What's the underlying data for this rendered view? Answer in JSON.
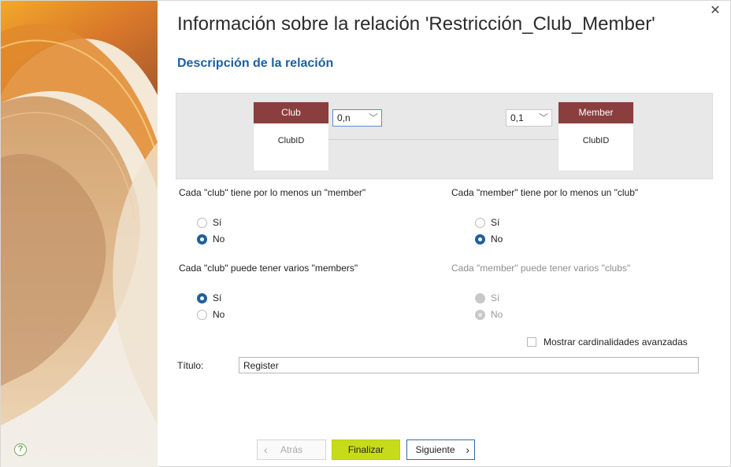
{
  "window": {
    "title": "Información sobre la relación 'Restricción_Club_Member'",
    "subtitle": "Descripción de la relación"
  },
  "icons": {
    "help": "question-circle-icon",
    "close": "close-icon"
  },
  "colors": {
    "entity_header": "#8b3e3e",
    "accent_blue": "#1f5f9e",
    "finish_button": "#c6dc1a"
  },
  "diagram": {
    "left_entity": {
      "name": "Club",
      "field": "ClubID"
    },
    "right_entity": {
      "name": "Member",
      "field": "ClubID"
    },
    "left_cardinality": "0,n",
    "right_cardinality": "0,1"
  },
  "questions": {
    "q1": {
      "text": "Cada \"club\" tiene por lo menos un \"member\"",
      "yes": "Sí",
      "no": "No",
      "selected": "No"
    },
    "q2": {
      "text": "Cada \"member\" tiene por lo menos un \"club\"",
      "yes": "Sí",
      "no": "No",
      "selected": "No"
    },
    "q3": {
      "text": "Cada \"club\" puede tener varios \"members\"",
      "yes": "Sí",
      "no": "No",
      "selected": "Sí"
    },
    "q4": {
      "text": "Cada \"member\" puede tener varios \"clubs\"",
      "yes": "Sí",
      "no": "No",
      "selected": "No",
      "disabled": true
    }
  },
  "advanced": {
    "label": "Mostrar cardinalidades avanzadas",
    "checked": false
  },
  "title_field": {
    "label": "Título:",
    "value": "Register"
  },
  "buttons": {
    "back": "Atrás",
    "finish": "Finalizar",
    "next": "Siguiente"
  }
}
